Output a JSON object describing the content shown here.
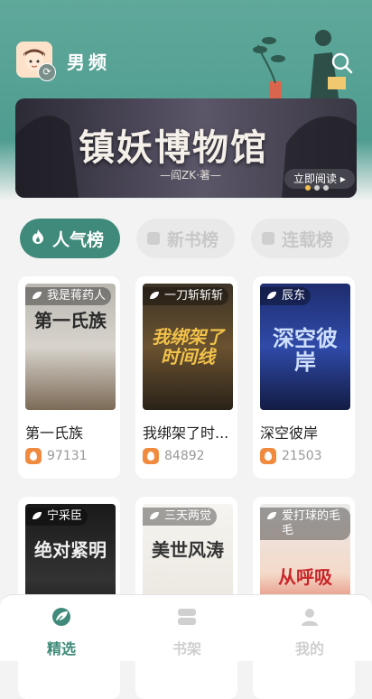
{
  "header": {
    "channel": "男频"
  },
  "banner": {
    "title": "镇妖博物馆",
    "author": "—阎ZK·著—",
    "read_label": "立即阅读"
  },
  "tabs": [
    {
      "label": "人气榜",
      "active": true
    },
    {
      "label": "新书榜",
      "active": false
    },
    {
      "label": "连载榜",
      "active": false
    }
  ],
  "books": [
    {
      "title": "第一氏族",
      "author": "我是蒋药人",
      "count": "97131",
      "cover_text": "第一氏族"
    },
    {
      "title": "我绑架了时...",
      "author": "一刀斩斩斩",
      "count": "84892",
      "cover_text": "我绑架了时间线"
    },
    {
      "title": "深空彼岸",
      "author": "辰东",
      "count": "21503",
      "cover_text": "深空彼岸"
    },
    {
      "title": "",
      "author": "宁采臣",
      "count": "",
      "cover_text": "绝对紧明"
    },
    {
      "title": "",
      "author": "三天两觉",
      "count": "",
      "cover_text": "美世风涛"
    },
    {
      "title": "",
      "author": "爱打球的毛毛",
      "count": "",
      "cover_text": "从呼吸"
    }
  ],
  "bottom_nav": [
    {
      "label": "精选",
      "icon": "leaf-icon",
      "active": true
    },
    {
      "label": "书架",
      "icon": "bookshelf-icon",
      "active": false
    },
    {
      "label": "我的",
      "icon": "profile-icon",
      "active": false
    }
  ],
  "colors": {
    "accent": "#3f8a7a",
    "header": "#5fa89a"
  }
}
